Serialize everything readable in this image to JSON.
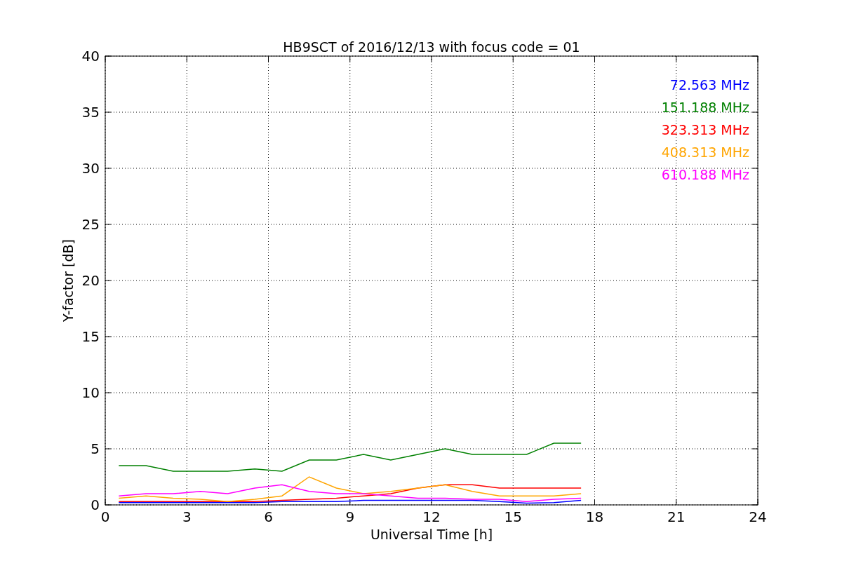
{
  "chart_data": {
    "type": "line",
    "title": "HB9SCT of 2016/12/13 with focus code = 01",
    "xlabel": "Universal Time [h]",
    "ylabel": "Y-factor [dB]",
    "x": [
      0.5,
      1.5,
      2.5,
      3.5,
      4.5,
      5.5,
      6.5,
      7.5,
      8.5,
      9.5,
      10.5,
      11.5,
      12.5,
      13.5,
      14.5,
      15.5,
      16.5,
      17.5
    ],
    "series": [
      {
        "name": "72.563 MHz",
        "color": "#0000ff",
        "values": [
          0.2,
          0.2,
          0.2,
          0.2,
          0.2,
          0.2,
          0.3,
          0.3,
          0.3,
          0.4,
          0.4,
          0.4,
          0.4,
          0.4,
          0.3,
          0.15,
          0.2,
          0.4
        ]
      },
      {
        "name": "151.188 MHz",
        "color": "#008000",
        "values": [
          3.5,
          3.5,
          3,
          3,
          3,
          3.2,
          3,
          4,
          4,
          4.5,
          4,
          4.5,
          5,
          4.5,
          4.5,
          4.5,
          5.5,
          5.5
        ]
      },
      {
        "name": "323.313 MHz",
        "color": "#ff0000",
        "values": [
          0.3,
          0.3,
          0.3,
          0.3,
          0.3,
          0.3,
          0.4,
          0.5,
          0.6,
          0.8,
          1,
          1.5,
          1.8,
          1.8,
          1.5,
          1.5,
          1.5,
          1.5
        ]
      },
      {
        "name": "408.313 MHz",
        "color": "#ffa500",
        "values": [
          0.6,
          0.8,
          0.6,
          0.5,
          0.3,
          0.5,
          0.8,
          2.5,
          1.5,
          1,
          1.2,
          1.5,
          1.8,
          1.2,
          0.8,
          0.8,
          0.8,
          1
        ]
      },
      {
        "name": "610.188 MHz",
        "color": "#ff00ff",
        "values": [
          0.8,
          1,
          1,
          1.2,
          1,
          1.5,
          1.8,
          1.2,
          1,
          1,
          0.8,
          0.6,
          0.6,
          0.5,
          0.5,
          0.3,
          0.5,
          0.6
        ]
      }
    ],
    "grid": true,
    "xlim": [
      0,
      24
    ],
    "ylim": [
      0,
      40
    ],
    "xticks": [
      0,
      3,
      6,
      9,
      12,
      15,
      18,
      21,
      24
    ],
    "yticks": [
      0,
      5,
      10,
      15,
      20,
      25,
      30,
      35,
      40
    ]
  }
}
